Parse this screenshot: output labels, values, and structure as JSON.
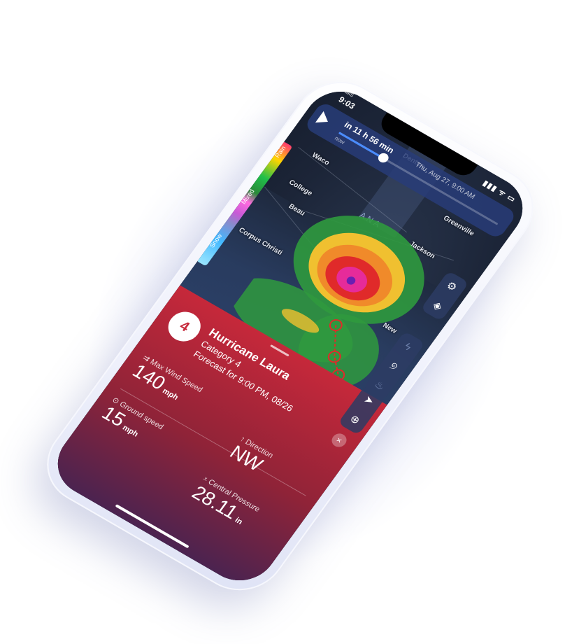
{
  "status_bar": {
    "carrier": "alls",
    "time": "9:03",
    "signal_icons": "▮▮▮ ᯤ ▭"
  },
  "timeline": {
    "title": "in 11 h 56 min",
    "date_label": "Thu, Aug 27, 9:00 AM",
    "start_label": "now",
    "progress": 0.28
  },
  "legend": {
    "labels": [
      "Rain",
      "Mixed",
      "Snow"
    ]
  },
  "map": {
    "cities": [
      "Waco",
      "College",
      "Beau",
      "Corpus Christi",
      "Jackson",
      "New",
      "Greenville",
      "Denton"
    ],
    "states": [
      "ANA"
    ]
  },
  "map_buttons": {
    "top": [
      {
        "icon": "gear-icon",
        "glyph": "⚙"
      },
      {
        "icon": "layers-icon",
        "glyph": "◈"
      }
    ],
    "middle": [
      {
        "icon": "lightning-icon",
        "glyph": "ϟ"
      },
      {
        "icon": "hurricane-icon",
        "glyph": "୭"
      },
      {
        "icon": "fire-icon",
        "glyph": "♨"
      }
    ],
    "bottom": [
      {
        "icon": "location-arrow-icon",
        "glyph": "➤"
      },
      {
        "icon": "zoom-icon",
        "glyph": "⊕"
      }
    ]
  },
  "storm_panel": {
    "category_number": "4",
    "title": "Hurricane Laura",
    "category": "Category 4",
    "forecast": "Forecast for 9:00 PM, 08/26",
    "close_glyph": "×",
    "stats": {
      "max_wind": {
        "label": "⇉ Max Wind Speed",
        "value": "140",
        "unit": "mph"
      },
      "direction": {
        "label": "↑ Direction",
        "value": "NW"
      },
      "ground_speed": {
        "label": "⊙ Ground speed",
        "value": "15",
        "unit": "mph"
      },
      "pressure": {
        "label": "⩡ Central Pressure",
        "value": "28.11",
        "unit": "in"
      }
    }
  },
  "colors": {
    "panel_top": "#c6283a",
    "panel_bottom": "#4b2350",
    "map_bg": "#1b2436",
    "accent": "#4a8cff"
  }
}
